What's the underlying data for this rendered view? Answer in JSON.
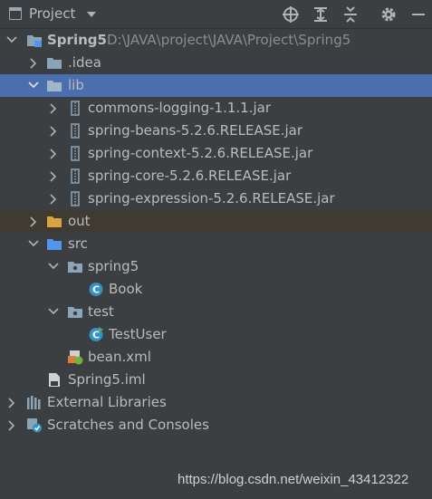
{
  "header": {
    "title": "Project",
    "icons": [
      "locate-icon",
      "expand-all-icon",
      "collapse-all-icon",
      "settings-icon",
      "hide-icon"
    ]
  },
  "tree": {
    "root": {
      "label": "Spring5",
      "path": "D:\\JAVA\\project\\JAVA\\Project\\Spring5"
    },
    "idea": "idea",
    "idea_prefix": ".",
    "lib": "lib",
    "jars": [
      "commons-logging-1.1.1.jar",
      "spring-beans-5.2.6.RELEASE.jar",
      "spring-context-5.2.6.RELEASE.jar",
      "spring-core-5.2.6.RELEASE.jar",
      "spring-expression-5.2.6.RELEASE.jar"
    ],
    "out": "out",
    "src": "src",
    "pkg_spring5": "spring5",
    "book": "Book",
    "pkg_test": "test",
    "test_user": "TestUser",
    "bean_xml": "bean.xml",
    "iml": "Spring5.iml",
    "external_libraries": "External Libraries",
    "scratches": "Scratches and Consoles"
  },
  "colors": {
    "background": "#3c3f41",
    "selection": "#4b6eaf",
    "excluded": "#3f3b33",
    "folder": "#8aa4b8",
    "source_folder": "#5394ec",
    "class_icon": "#3592c4"
  },
  "watermark": "https://blog.csdn.net/weixin_43412322"
}
